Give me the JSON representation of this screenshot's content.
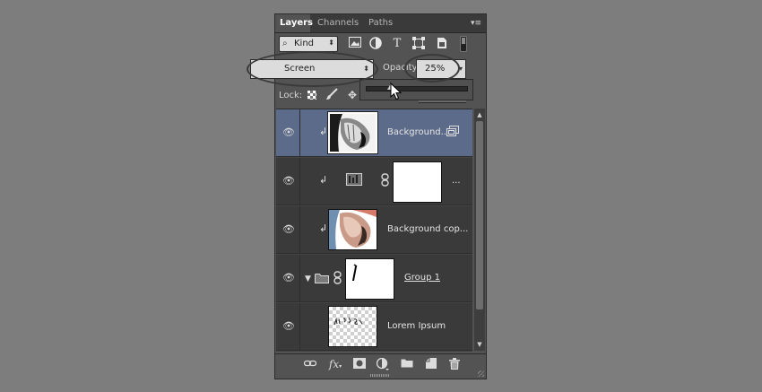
{
  "tabs": [
    {
      "label": "Layers",
      "active": true
    },
    {
      "label": "Channels",
      "active": false
    },
    {
      "label": "Paths",
      "active": false
    }
  ],
  "panel_menu_icon": "panel-menu-icon",
  "filter": {
    "kind_label": "Kind",
    "icons": [
      "image-filter-icon",
      "adjustment-filter-icon",
      "type-filter-icon",
      "shape-filter-icon",
      "smart-object-filter-icon"
    ]
  },
  "blend_mode": "Screen",
  "opacity": {
    "label": "Opacity:",
    "value": "25%",
    "slider_fraction": 0.25
  },
  "lock": {
    "label": "Lock:",
    "icons": [
      "lock-transparent-icon",
      "lock-image-icon",
      "lock-position-icon"
    ]
  },
  "layers": [
    {
      "name": "Background...",
      "selected": true,
      "clipped": true,
      "thumb": "bw-shoulder",
      "badge": "smart-object-icon"
    },
    {
      "name": "...",
      "selected": false,
      "clipped": true,
      "thumb": "white-mask",
      "adjustment_icon": "levels-icon",
      "link": true
    },
    {
      "name": "Background cop...",
      "selected": false,
      "clipped": true,
      "thumb": "color-shoulder"
    },
    {
      "name": "Group 1",
      "selected": false,
      "group": true,
      "thumb": "mask-stroke",
      "link": true
    },
    {
      "name": "Lorem Ipsum",
      "selected": false,
      "thumb": "text-transparent"
    }
  ],
  "bottom_icons": [
    "link-layers-icon",
    "fx-icon",
    "add-mask-icon",
    "new-adjustment-icon",
    "new-group-icon",
    "new-layer-icon",
    "delete-icon"
  ],
  "colors": {
    "selected_row": "#5d6b8a",
    "panel_bg": "#535353",
    "page_bg": "#7d7d7d"
  }
}
